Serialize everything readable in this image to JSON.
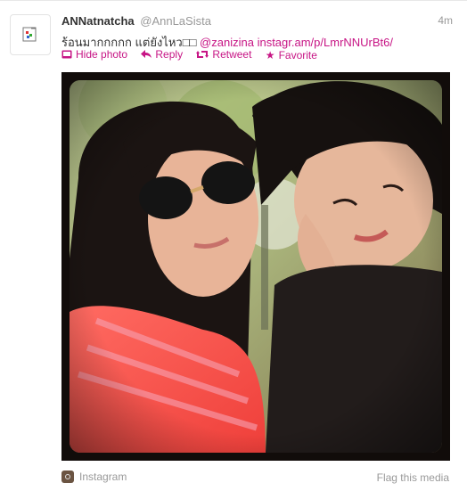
{
  "tweet": {
    "fullname": "ANNatnatcha",
    "username": "@AnnLaSista",
    "time": "4m",
    "text": "ร้อนมากกกกก แต่ยังไหว□□",
    "mention": "@zanizina",
    "link": "instagr.am/p/LmrNNUrBt6/"
  },
  "actions": {
    "hide_photo": "Hide photo",
    "reply": "Reply",
    "retweet": "Retweet",
    "favorite": "Favorite"
  },
  "media": {
    "source": "Instagram",
    "flag": "Flag this media"
  },
  "colors": {
    "link": "#c71585",
    "muted": "#999999"
  }
}
